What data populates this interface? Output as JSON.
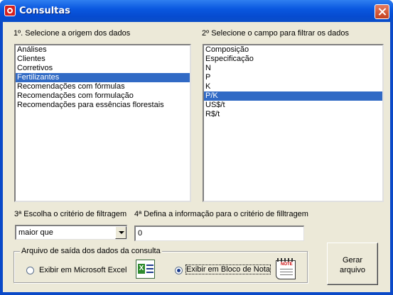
{
  "window": {
    "title": "Consultas"
  },
  "origem": {
    "label": "1º. Selecione a origem dos dados",
    "items": [
      "Análises",
      "Clientes",
      "Corretivos",
      "Fertilizantes",
      "Recomendações com fórmulas",
      "Recomendações com formulação",
      "Recomendações para essências florestais"
    ],
    "selected": "Fertilizantes"
  },
  "campo": {
    "label": "2º Selecione o campo para filtrar os dados",
    "items": [
      "Composição",
      "Especificação",
      "N",
      "P",
      "K",
      "P/K",
      "US$/t",
      "R$/t"
    ],
    "selected": "P/K"
  },
  "criterio": {
    "label": "3ª Escolha o critério de filtragem",
    "value": "maior que"
  },
  "informacao": {
    "label": "4ª Defina a informação para  o critério de filltragem",
    "value": "0"
  },
  "saida": {
    "legend": "Arquivo de saída dos dados da consulta",
    "option_excel": "Exibir em Microsoft Excel",
    "option_bloco": "Exibir em Bloco de Nota",
    "selected": "bloco",
    "excel_icon": "excel-icon",
    "note_icon": "notepad-icon",
    "note_text": "NOTE"
  },
  "gerar": {
    "line1": "Gerar",
    "line2": "arquivo"
  }
}
